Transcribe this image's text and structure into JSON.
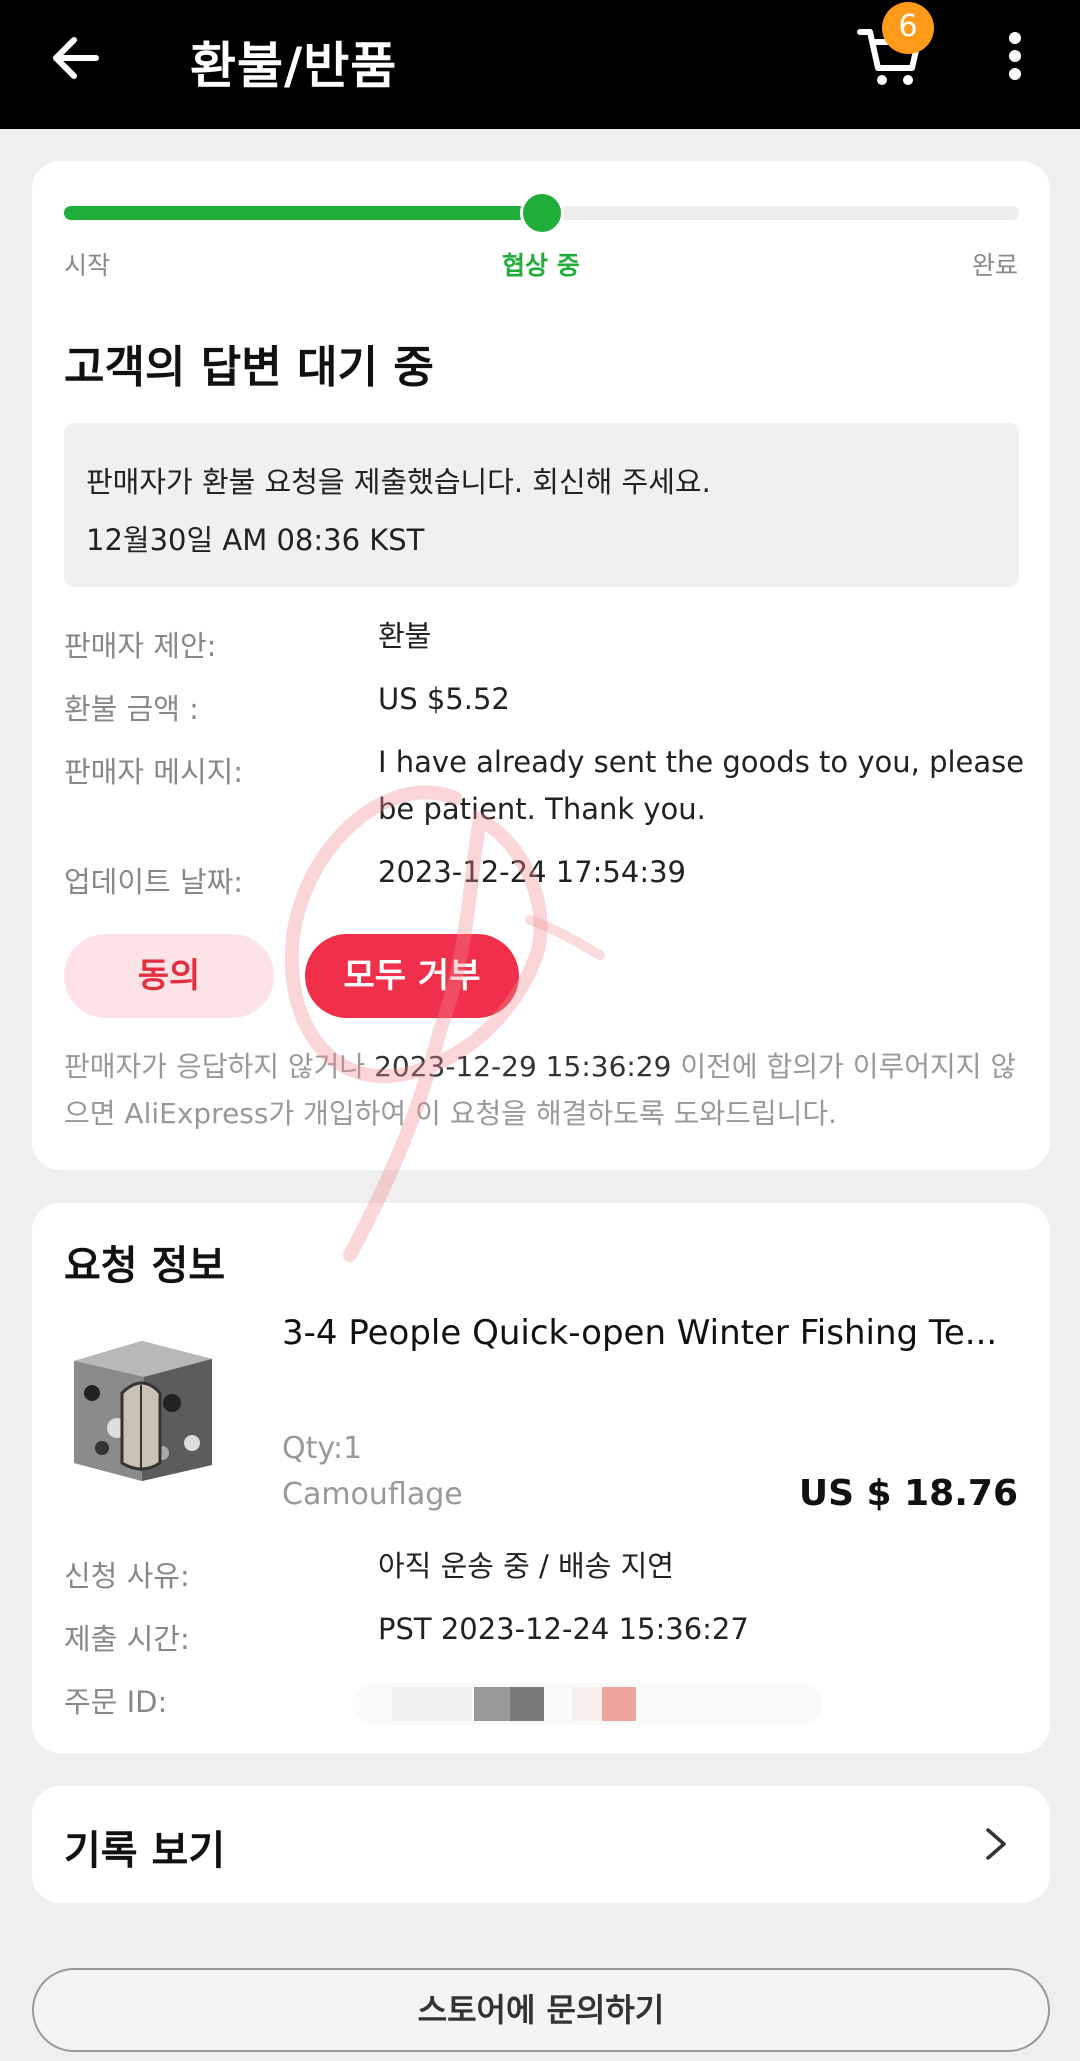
{
  "header": {
    "title": "환불/반품",
    "cart_badge": "6"
  },
  "progress": {
    "fraction": 0.5,
    "steps": [
      "시작",
      "협상 중",
      "완료"
    ],
    "active_color": "#1fae3a"
  },
  "status": {
    "title": "고객의 답변 대기 중",
    "notice_line1": "판매자가 환불 요청을 제출했습니다. 회신해 주세요.",
    "notice_line2": "12월30일 AM 08:36 KST"
  },
  "details": {
    "proposal_label": "판매자 제안:",
    "proposal_value": "환불",
    "amount_label": "환불 금액 :",
    "amount_value": "US $5.52",
    "message_label": "판매자 메시지:",
    "message_value": "I have already sent the goods to you, please be patient. Thank you.",
    "updated_label": "업데이트 날짜:",
    "updated_value": "2023-12-24 17:54:39"
  },
  "actions": {
    "agree_label": "동의",
    "reject_label": "모두 거부"
  },
  "footnote": {
    "prefix": "판매자가 응답하지 않거나 ",
    "deadline": "2023-12-29 15:36:29",
    "suffix": " 이전에 합의가 이루어지지 않으면 AliExpress가 개입하여 이 요청을 해결하도록 도와드립니다."
  },
  "request_info": {
    "title": "요청 정보",
    "product_name": "3-4 People Quick-open Winter Fishing Te...",
    "qty": "Qty:1",
    "variant": "Camouflage",
    "price": "US $ 18.76",
    "reason_label": "신청 사유:",
    "reason_value": "아직 운송 중 / 배송 지연",
    "submitted_label": "제출 시간:",
    "submitted_value": "PST 2023-12-24 15:36:27",
    "order_id_label": "주문 ID:"
  },
  "history": {
    "title": "기록 보기"
  },
  "contact": {
    "label": "스토어에 문의하기"
  },
  "colors": {
    "accent_green": "#1fae3a",
    "reject_red": "#f0304a",
    "agree_bg": "#fde3e6",
    "badge_orange": "#ff9a1a"
  }
}
